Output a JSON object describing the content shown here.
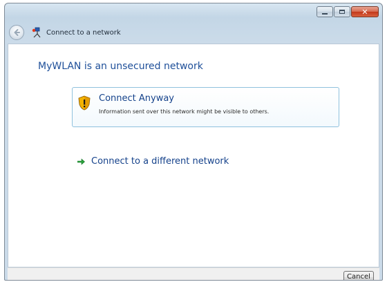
{
  "window": {
    "title": "Connect to a network"
  },
  "main": {
    "instruction": "MyWLAN is an unsecured network",
    "connect_anyway": {
      "title": "Connect Anyway",
      "description": "Information sent over this network might be visible to others."
    },
    "connect_different": {
      "label": "Connect to a different network"
    }
  },
  "footer": {
    "cancel_label": "Cancel"
  },
  "icons": {
    "back": "back-arrow-icon",
    "network": "network-icon",
    "shield": "security-shield-warning-icon",
    "arrow": "green-arrow-icon"
  },
  "colors": {
    "instruction": "#1e4f99",
    "link": "#15428b",
    "close_button": "#c2381a",
    "command_border": "#8fc1dd"
  }
}
